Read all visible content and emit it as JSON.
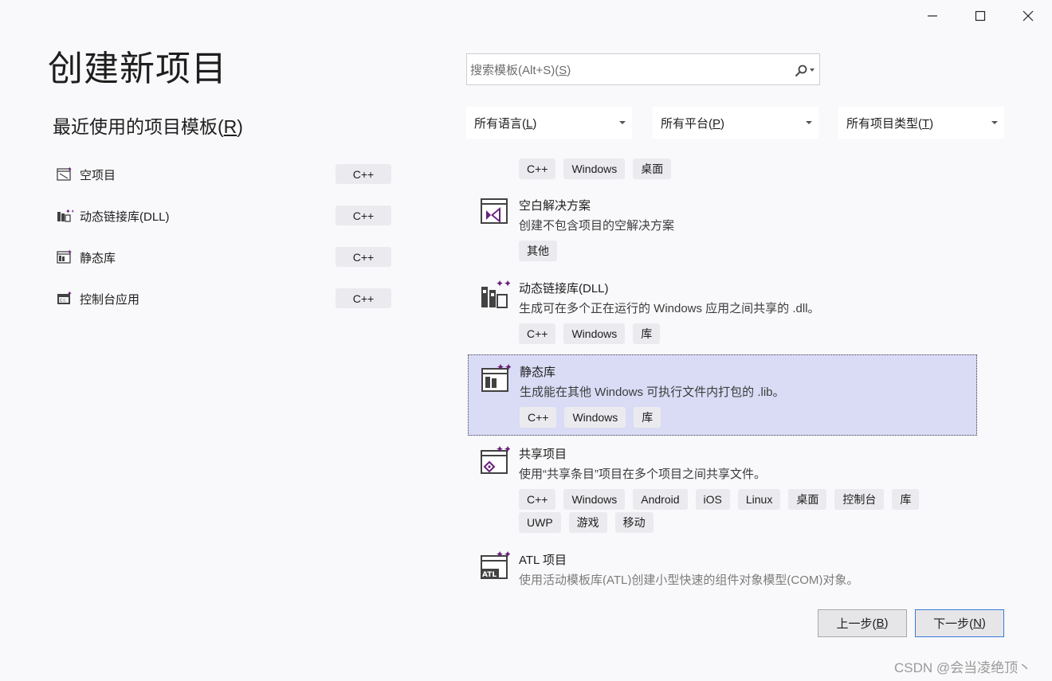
{
  "window_controls": {
    "minimize": "minimize",
    "maximize": "maximize",
    "close": "close"
  },
  "page_title": "创建新项目",
  "recent": {
    "title": "最近使用的项目模板(",
    "title_key": "R",
    "title_end": ")",
    "items": [
      {
        "label": "空项目",
        "tag": "C++",
        "icon": "empty-project-icon"
      },
      {
        "label": "动态链接库(DLL)",
        "tag": "C++",
        "icon": "dll-icon"
      },
      {
        "label": "静态库",
        "tag": "C++",
        "icon": "static-library-icon"
      },
      {
        "label": "控制台应用",
        "tag": "C++",
        "icon": "console-app-icon"
      }
    ]
  },
  "search": {
    "placeholder_pre": "搜索模板(Alt+S)(",
    "placeholder_key": "S",
    "placeholder_end": ")"
  },
  "filters": {
    "language": {
      "pre": "所有语言(",
      "key": "L",
      "end": ")"
    },
    "platform": {
      "pre": "所有平台(",
      "key": "P",
      "end": ")"
    },
    "project_type": {
      "pre": "所有项目类型(",
      "key": "T",
      "end": ")"
    }
  },
  "templates": [
    {
      "name": "",
      "desc": "",
      "tags": [
        "C++",
        "Windows",
        "桌面"
      ]
    },
    {
      "name": "空白解决方案",
      "desc": "创建不包含项目的空解决方案",
      "tags": [
        "其他"
      ],
      "icon": "visual-studio-solution-icon"
    },
    {
      "name": "动态链接库(DLL)",
      "desc": "生成可在多个正在运行的 Windows 应用之间共享的 .dll。",
      "tags": [
        "C++",
        "Windows",
        "库"
      ],
      "icon": "dll-icon"
    },
    {
      "name": "静态库",
      "desc": "生成能在其他 Windows 可执行文件内打包的 .lib。",
      "tags": [
        "C++",
        "Windows",
        "库"
      ],
      "icon": "static-library-icon",
      "selected": true
    },
    {
      "name": "共享项目",
      "desc": "使用“共享条目”项目在多个项目之间共享文件。",
      "tags": [
        "C++",
        "Windows",
        "Android",
        "iOS",
        "Linux",
        "桌面",
        "控制台",
        "库",
        "UWP",
        "游戏",
        "移动"
      ],
      "icon": "shared-project-icon"
    },
    {
      "name": "ATL 项目",
      "desc": "使用活动模板库(ATL)创建小型快速的组件对象模型(COM)对象。",
      "tags": [],
      "icon": "atl-project-icon"
    }
  ],
  "buttons": {
    "back": {
      "pre": "上一步(",
      "key": "B",
      "end": ")"
    },
    "next": {
      "pre": "下一步(",
      "key": "N",
      "end": ")"
    }
  },
  "watermark": "CSDN @会当凌绝顶丶",
  "colors": {
    "accent": "#68217a",
    "selection": "#dadcf6",
    "next_border": "#3c78d8"
  }
}
